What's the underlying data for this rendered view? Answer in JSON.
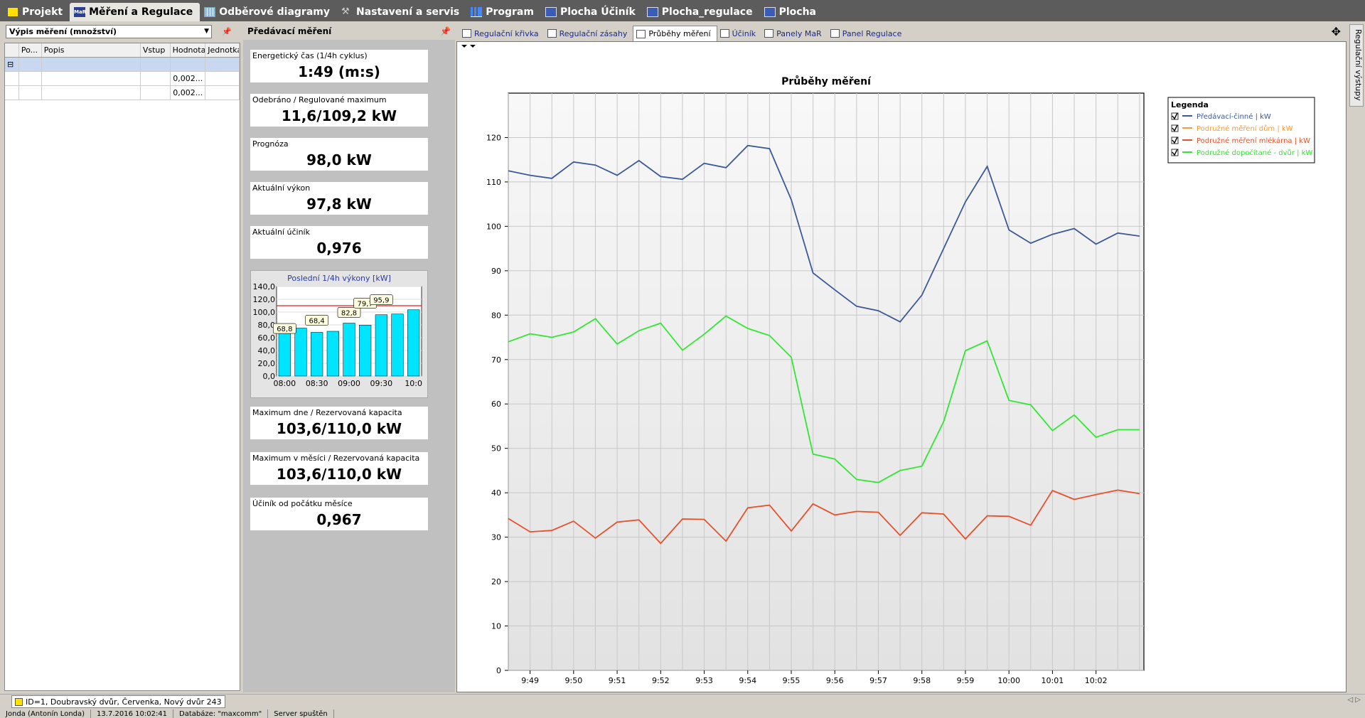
{
  "top_tabs": [
    {
      "label": "Projekt",
      "icon": "project-icon",
      "active": false
    },
    {
      "label": "Měření a Regulace",
      "icon": "mar-icon",
      "active": true
    },
    {
      "label": "Odběrové diagramy",
      "icon": "grid-icon",
      "active": false
    },
    {
      "label": "Nastavení a servis",
      "icon": "wrench-icon",
      "active": false
    },
    {
      "label": "Program",
      "icon": "bars-icon",
      "active": false
    },
    {
      "label": "Plocha Účiník",
      "icon": "plocha-icon",
      "active": false
    },
    {
      "label": "Plocha_regulace",
      "icon": "plocha-icon",
      "active": false
    },
    {
      "label": "Plocha",
      "icon": "plocha-icon",
      "active": false
    }
  ],
  "left_panel": {
    "selector": "Výpis měření (množství)",
    "columns": [
      "Po...",
      "Popis",
      "Vstup",
      "Hodnota",
      "Jednotka"
    ],
    "rows": [
      {
        "value": ""
      },
      {
        "value": "0,002..."
      },
      {
        "value": "0,002..."
      }
    ]
  },
  "middle_panel": {
    "title": "Předávací měření",
    "cards": [
      {
        "label": "Energetický čas (1/4h cyklus)",
        "value": "1:49 (m:s)"
      },
      {
        "label": "Odebráno / Regulované maximum",
        "value": "11,6/109,2 kW"
      },
      {
        "label": "Prognóza",
        "value": "98,0 kW"
      },
      {
        "label": "Aktuální výkon",
        "value": "97,8 kW"
      },
      {
        "label": "Aktuální účiník",
        "value": "0,976"
      },
      {
        "label": "Maximum dne / Rezervovaná kapacita",
        "value": "103,6/110,0 kW"
      },
      {
        "label": "Maximum v měsíci / Rezervovaná kapacita",
        "value": "103,6/110,0 kW"
      },
      {
        "label": "Účiník od počátku měsíce",
        "value": "0,967"
      }
    ]
  },
  "mini_chart": {
    "type": "bar",
    "title": "Poslední 1/4h výkony [kW]",
    "ylim": [
      0,
      140
    ],
    "yticks": [
      "0,0",
      "20,0",
      "40,0",
      "60,0",
      "80,0",
      "100,0",
      "120,0",
      "140,0"
    ],
    "xticks": [
      "08:00",
      "08:30",
      "09:00",
      "09:30",
      "10:0"
    ],
    "values": [
      68.8,
      75,
      68.4,
      70,
      82.8,
      79.7,
      95.9,
      97,
      103.6
    ],
    "limit": 110,
    "labels": [
      {
        "text": "68,8",
        "i": 0
      },
      {
        "text": "68,4",
        "i": 2
      },
      {
        "text": "82,8",
        "i": 4
      },
      {
        "text": "79,7",
        "i": 5
      },
      {
        "text": "95,9",
        "i": 6
      }
    ],
    "bar_color": "#00e5ff",
    "limit_color": "#e02020"
  },
  "right_panel": {
    "tabs": [
      {
        "label": "Regulační křivka",
        "active": false
      },
      {
        "label": "Regulační zásahy",
        "active": false
      },
      {
        "label": "Průběhy měření",
        "active": true
      },
      {
        "label": "Účiník",
        "active": false
      },
      {
        "label": "Panely MaR",
        "active": false
      },
      {
        "label": "Panel Regulace",
        "active": false
      }
    ],
    "side_button": "Regulační výstupy"
  },
  "chart_data": {
    "type": "line",
    "title": "Průběhy měření",
    "ylim": [
      0,
      130
    ],
    "yticks": [
      0,
      10,
      20,
      30,
      40,
      50,
      60,
      70,
      80,
      90,
      100,
      110,
      120
    ],
    "xticks": [
      "9:49",
      "9:50",
      "9:51",
      "9:52",
      "9:53",
      "9:54",
      "9:55",
      "9:56",
      "9:57",
      "9:58",
      "9:59",
      "10:00",
      "10:01",
      "10:02"
    ],
    "x_range": [
      0,
      29.2
    ],
    "xtick_positions": [
      1,
      3,
      5,
      7,
      9,
      11,
      13,
      15,
      17,
      19,
      21,
      23,
      25,
      27
    ],
    "grid": true,
    "legend_title": "Legenda",
    "legend_position": "top-right",
    "series": [
      {
        "name": "Předávací-činné | kW",
        "color": "#3b5998",
        "checked": true,
        "values": [
          112.5,
          111.5,
          110.8,
          114.5,
          113.8,
          111.5,
          114.8,
          111.2,
          110.6,
          114.2,
          113.2,
          118.2,
          117.5,
          106,
          89.5,
          85.7,
          82,
          81,
          78.5,
          84.5,
          95,
          105.5,
          113.5,
          99.2,
          96.2,
          98.2,
          99.5,
          96,
          98.5,
          97.8
        ]
      },
      {
        "name": "Podružné měření dům | kW",
        "color": "#ff9933",
        "checked": true,
        "values": []
      },
      {
        "name": "Podružné měření mlékárna | kW",
        "color": "#e8502a",
        "checked": true,
        "values": [
          34.2,
          31.2,
          31.5,
          33.6,
          29.8,
          33.4,
          33.9,
          28.6,
          34.1,
          34,
          29.1,
          36.6,
          37.2,
          31.4,
          37.5,
          35,
          35.8,
          35.6,
          30.4,
          35.5,
          35.2,
          29.6,
          34.8,
          34.7,
          32.7,
          40.5,
          38.5,
          39.6,
          40.6,
          39.8
        ]
      },
      {
        "name": "Podružné dopočítané - dvůr | kW",
        "color": "#33e633",
        "checked": true,
        "values": [
          74,
          75.8,
          75,
          76.2,
          79.2,
          73.5,
          76.5,
          78.2,
          72.1,
          75.7,
          79.8,
          77,
          75.4,
          70.5,
          48.7,
          47.6,
          43,
          42.3,
          45,
          46,
          56,
          72,
          74.2,
          60.8,
          59.8,
          54,
          57.5,
          52.5,
          54.2,
          54.2
        ]
      }
    ]
  },
  "status": {
    "project_tab": "ID=1, Doubravský dvůr, Červenka, Nový dvůr 243",
    "user": "Jonda (Antonín Londa)",
    "datetime": "13.7.2016 10:02:41",
    "database": "Databáze: \"maxcomm\"",
    "server": "Server spuštěn"
  }
}
